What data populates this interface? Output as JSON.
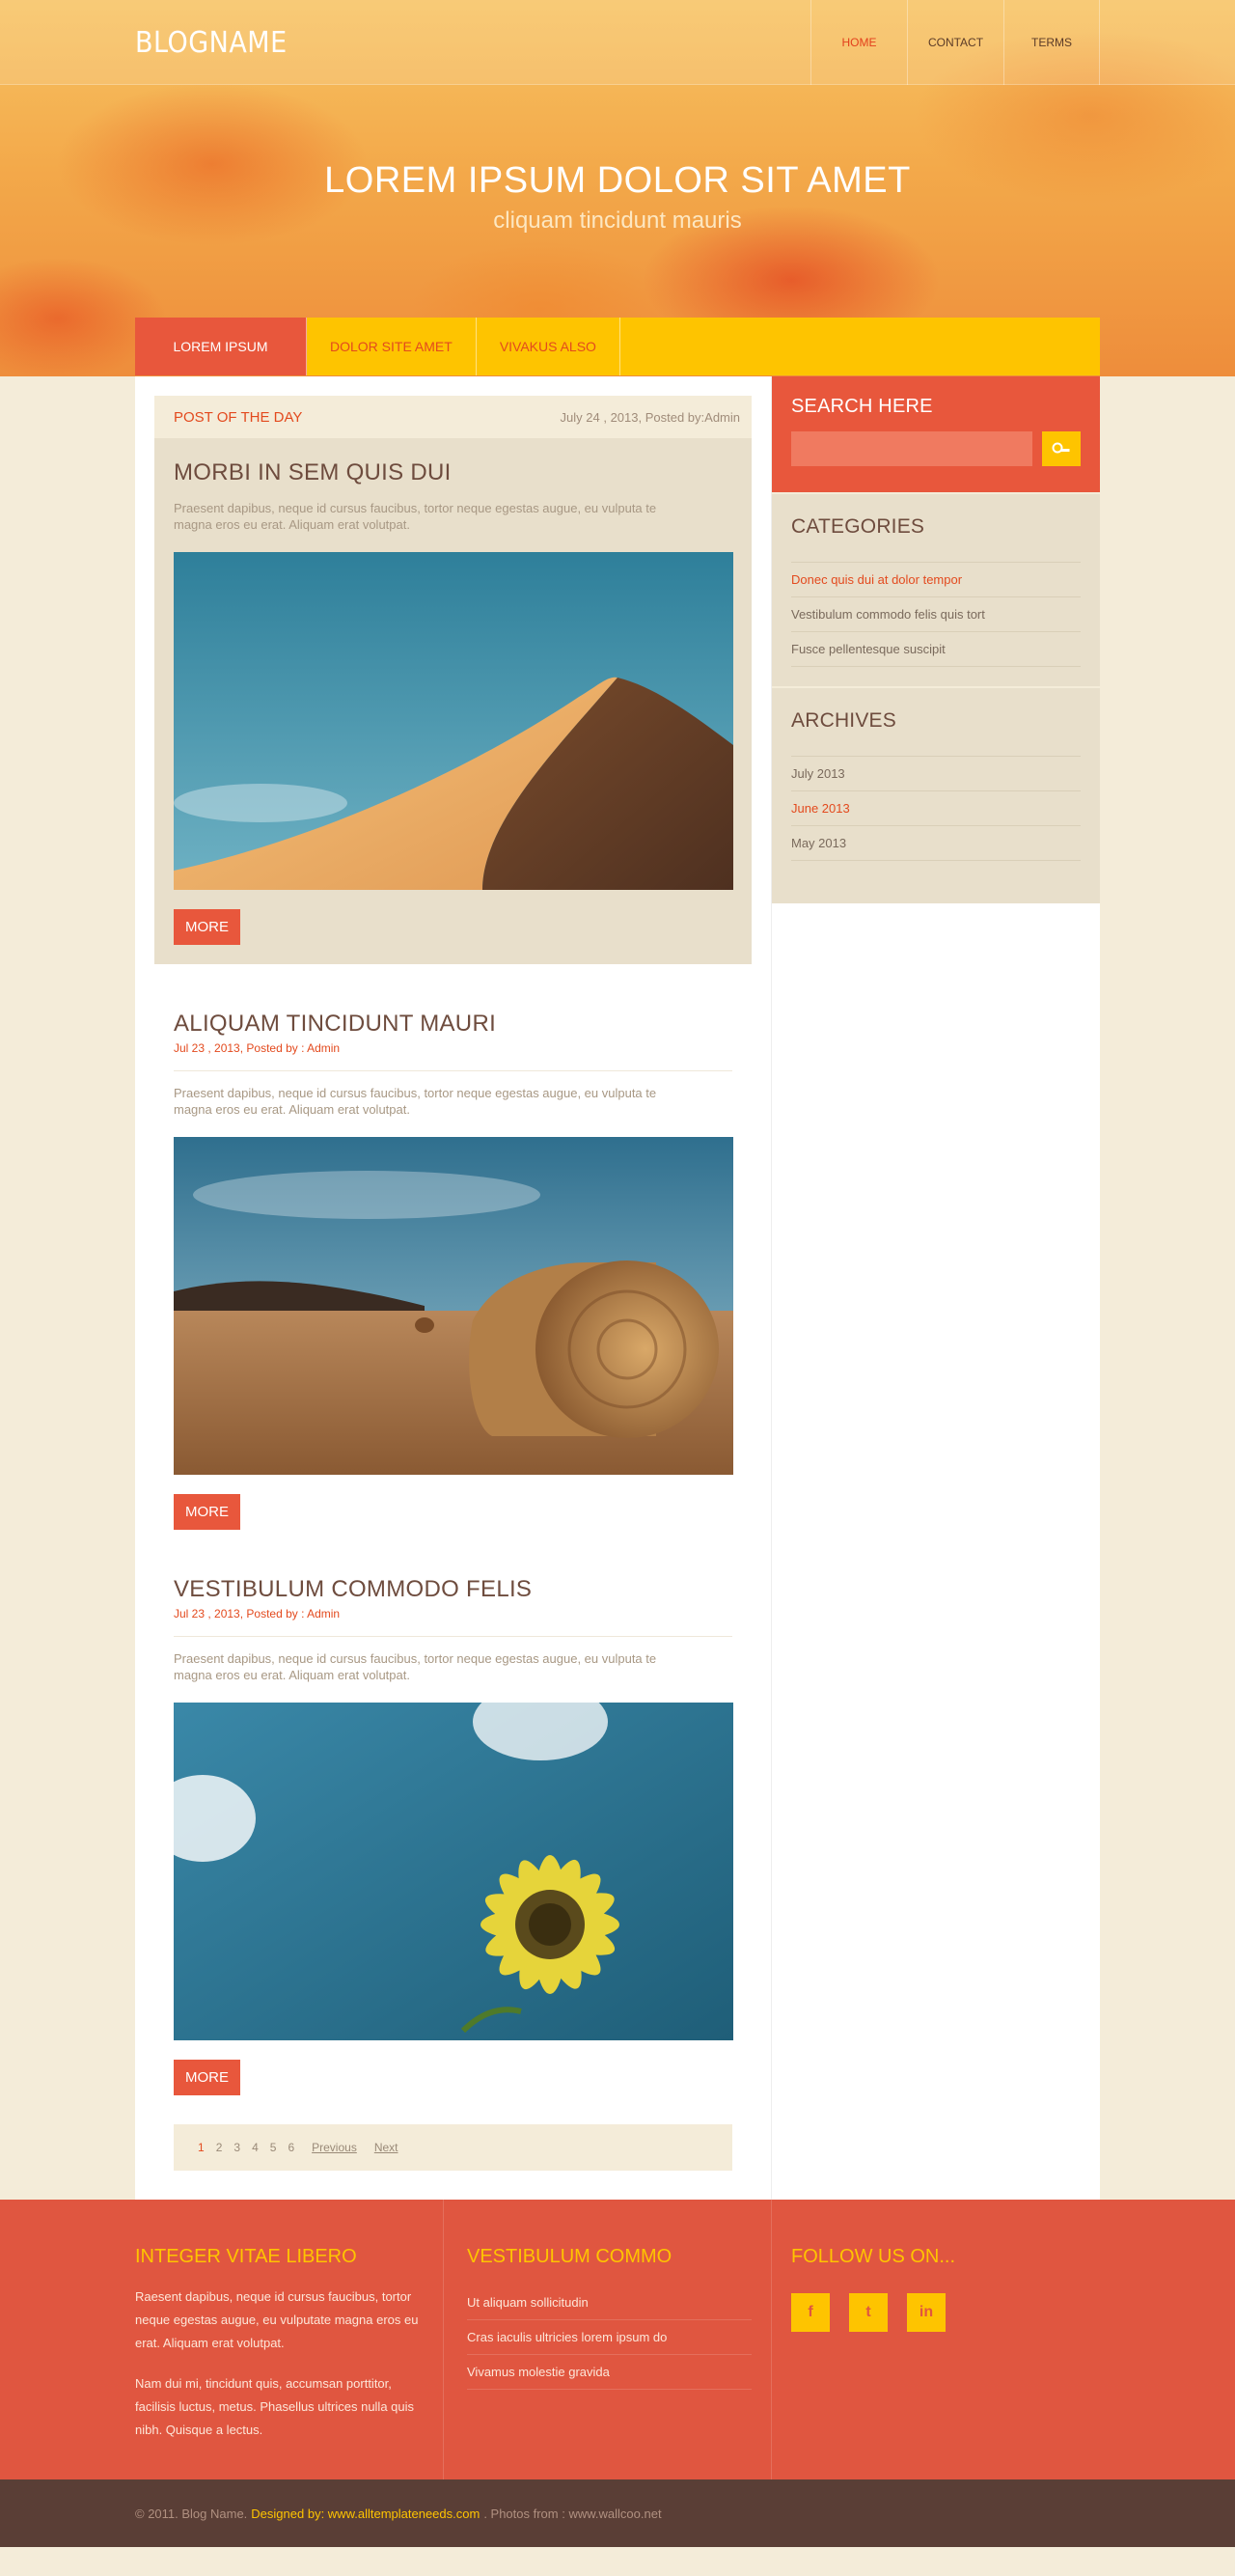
{
  "header": {
    "logo": "BLOGNAME",
    "nav": [
      "HOME",
      "CONTACT",
      "TERMS"
    ],
    "active_nav": "HOME"
  },
  "hero": {
    "title": "LOREM IPSUM DOLOR SIT AMET",
    "subtitle": "cliquam tincidunt mauris"
  },
  "category_nav": [
    "LOREM IPSUM",
    "DOLOR SITE AMET",
    "VIVAKUS ALSO"
  ],
  "post_of_day": {
    "label": "POST OF THE DAY",
    "meta": "July 24 , 2013, Posted by:Admin",
    "title": "MORBI IN SEM QUIS DUI",
    "excerpt": "Praesent dapibus, neque id cursus faucibus, tortor neque egestas augue, eu vulputa te magna eros eu erat. Aliquam erat volutpat.",
    "more": "MORE"
  },
  "posts": [
    {
      "title": "ALIQUAM TINCIDUNT MAURI",
      "meta": "Jul 23 , 2013, Posted by : Admin",
      "excerpt": "Praesent dapibus, neque id cursus faucibus, tortor neque egestas augue, eu vulputa te magna eros eu erat. Aliquam erat volutpat.",
      "more": "MORE"
    },
    {
      "title": "VESTIBULUM COMMODO FELIS",
      "meta": "Jul 23 , 2013, Posted by : Admin",
      "excerpt": "Praesent dapibus, neque id cursus faucibus, tortor neque egestas augue, eu vulputa te magna eros eu erat. Aliquam erat volutpat.",
      "more": "MORE"
    }
  ],
  "pager": {
    "pages": [
      "1",
      "2",
      "3",
      "4",
      "5",
      "6"
    ],
    "current": "1",
    "previous": "Previous",
    "next": "Next"
  },
  "sidebar": {
    "search_title": "SEARCH HERE",
    "search_placeholder": "",
    "categories_title": "CATEGORIES",
    "categories": [
      "Donec quis dui at dolor tempor",
      "Vestibulum commodo felis quis tort",
      "Fusce pellentesque suscipit"
    ],
    "archives_title": "ARCHIVES",
    "archives": [
      "July 2013",
      "June 2013",
      "May 2013"
    ]
  },
  "footer": {
    "col1_title": "INTEGER VITAE LIBERO",
    "col1_p1": "Raesent dapibus, neque id cursus faucibus, tortor neque egestas augue, eu vulputate magna eros eu erat. Aliquam erat volutpat.",
    "col1_p2": "Nam dui mi, tincidunt quis, accumsan porttitor, facilisis luctus, metus. Phasellus ultrices nulla quis nibh. Quisque a lectus.",
    "col2_title": "VESTIBULUM COMMO",
    "col2_links": [
      "Ut aliquam sollicitudin",
      "Cras iaculis ultricies lorem ipsum do",
      "Vivamus molestie gravida"
    ],
    "col3_title": "FOLLOW US ON...",
    "social": [
      "f",
      "t",
      "in"
    ]
  },
  "copyright": {
    "text1": "© 2011. Blog Name.",
    "designed": "Designed by: www.alltemplateneeds.com",
    "text2": ". Photos from : www.wallcoo.net"
  },
  "colors": {
    "accent_red": "#e8573c",
    "accent_yellow": "#fec400",
    "footer_bg": "#e05640",
    "copyright_bg": "#5a3e36"
  }
}
